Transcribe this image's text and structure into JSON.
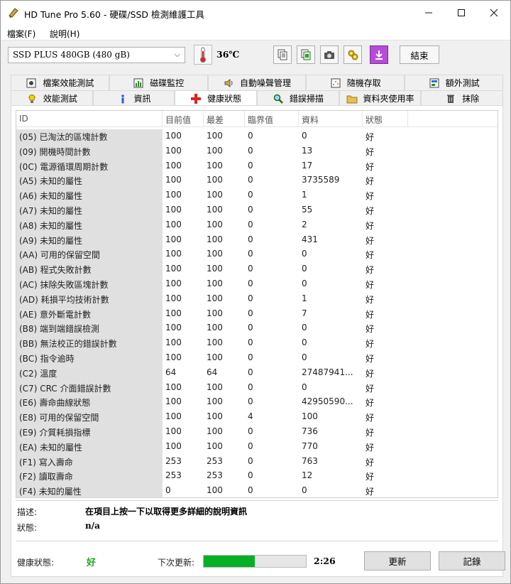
{
  "window": {
    "title": "HD Tune Pro 5.60 - 硬碟/SSD 檢測維護工具",
    "controls": {
      "minimize": "—",
      "maximize": "☐",
      "close": "✕"
    }
  },
  "menu": {
    "file": "檔案(F)",
    "help": "說明(H)"
  },
  "toolbar": {
    "drive": "SSD PLUS 480GB (480 gB)",
    "temperature": "36℃",
    "exit_label": "結束",
    "buttons": [
      "copy-text-icon",
      "copy-screen-icon",
      "camera-icon",
      "tools-icon",
      "download-icon"
    ]
  },
  "tabs": {
    "row1": [
      {
        "label": "檔案效能測試",
        "icon": "file-benchmark-icon"
      },
      {
        "label": "磁碟監控",
        "icon": "disk-monitor-icon"
      },
      {
        "label": "自動噪聲管理",
        "icon": "speaker-icon"
      },
      {
        "label": "隨機存取",
        "icon": "random-access-icon"
      },
      {
        "label": "額外測試",
        "icon": "extra-tests-icon"
      }
    ],
    "row2": [
      {
        "label": "效能測試",
        "icon": "lightbulb-icon"
      },
      {
        "label": "資訊",
        "icon": "info-icon"
      },
      {
        "label": "健康狀態",
        "icon": "health-cross-icon",
        "active": true
      },
      {
        "label": "錯誤掃描",
        "icon": "magnifier-icon"
      },
      {
        "label": "資料夾使用率",
        "icon": "folder-icon"
      },
      {
        "label": "抹除",
        "icon": "trash-icon"
      }
    ]
  },
  "table": {
    "columns": [
      "ID",
      "目前值",
      "最差",
      "臨界值",
      "資料",
      "狀態"
    ],
    "rows": [
      [
        "(05) 已淘汰的區塊計數",
        "100",
        "100",
        "0",
        "0",
        "好"
      ],
      [
        "(09) 開機時間計數",
        "100",
        "100",
        "0",
        "13",
        "好"
      ],
      [
        "(0C) 電源循環周期計數",
        "100",
        "100",
        "0",
        "17",
        "好"
      ],
      [
        "(A5) 未知的屬性",
        "100",
        "100",
        "0",
        "3735589",
        "好"
      ],
      [
        "(A6) 未知的屬性",
        "100",
        "100",
        "0",
        "1",
        "好"
      ],
      [
        "(A7) 未知的屬性",
        "100",
        "100",
        "0",
        "55",
        "好"
      ],
      [
        "(A8) 未知的屬性",
        "100",
        "100",
        "0",
        "2",
        "好"
      ],
      [
        "(A9) 未知的屬性",
        "100",
        "100",
        "0",
        "431",
        "好"
      ],
      [
        "(AA) 可用的保留空間",
        "100",
        "100",
        "0",
        "0",
        "好"
      ],
      [
        "(AB) 程式失敗計數",
        "100",
        "100",
        "0",
        "0",
        "好"
      ],
      [
        "(AC) 抹除失敗區塊計數",
        "100",
        "100",
        "0",
        "0",
        "好"
      ],
      [
        "(AD) 耗損平均技術計數",
        "100",
        "100",
        "0",
        "1",
        "好"
      ],
      [
        "(AE) 意外斷電計數",
        "100",
        "100",
        "0",
        "7",
        "好"
      ],
      [
        "(B8) 端到端錯誤檢測",
        "100",
        "100",
        "0",
        "0",
        "好"
      ],
      [
        "(BB) 無法校正的錯誤計數",
        "100",
        "100",
        "0",
        "0",
        "好"
      ],
      [
        "(BC) 指令逾時",
        "100",
        "100",
        "0",
        "0",
        "好"
      ],
      [
        "(C2) 溫度",
        "64",
        "64",
        "0",
        "27487941...",
        "好"
      ],
      [
        "(C7) CRC 介面錯誤計數",
        "100",
        "100",
        "0",
        "0",
        "好"
      ],
      [
        "(E6) 壽命曲線狀態",
        "100",
        "100",
        "0",
        "42950590...",
        "好"
      ],
      [
        "(E8) 可用的保留空間",
        "100",
        "100",
        "4",
        "100",
        "好"
      ],
      [
        "(E9) 介質耗損指標",
        "100",
        "100",
        "0",
        "736",
        "好"
      ],
      [
        "(EA) 未知的屬性",
        "100",
        "100",
        "0",
        "770",
        "好"
      ],
      [
        "(F1) 寫入壽命",
        "253",
        "253",
        "0",
        "763",
        "好"
      ],
      [
        "(F2) 讀取壽命",
        "253",
        "253",
        "0",
        "12",
        "好"
      ],
      [
        "(F4) 未知的屬性",
        "0",
        "100",
        "0",
        "0",
        "好"
      ]
    ]
  },
  "details": {
    "description_label": "描述:",
    "description_value": "在項目上按一下以取得更多詳細的說明資訊",
    "status_label": "狀態:",
    "status_value": "n/a"
  },
  "footer": {
    "health_label": "健康狀態:",
    "health_value": "好",
    "health_color": "#19a81f",
    "next_update_label": "下次更新:",
    "progress_fraction": 0.5,
    "countdown": "2:26",
    "update_button": "更新",
    "log_button": "記錄"
  }
}
